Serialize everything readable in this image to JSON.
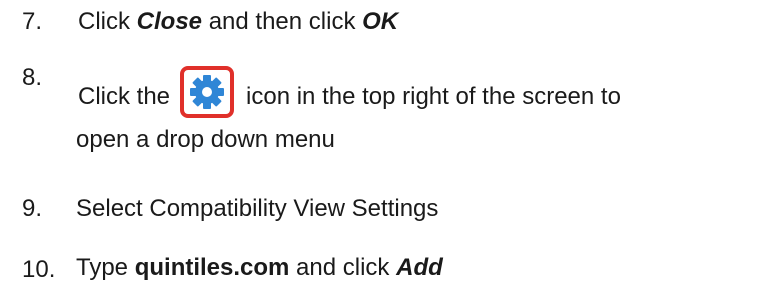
{
  "steps": [
    {
      "number": "7.",
      "parts": {
        "a": "Click ",
        "b": "Close",
        "c": " and then click ",
        "d": "OK"
      }
    },
    {
      "number": "8.",
      "parts": {
        "a": "Click the",
        "c": "icon in the top right of the screen to",
        "line2": "open a drop down menu"
      },
      "icon": "gear-settings-icon",
      "icon_colors": {
        "border": "#e0302a",
        "gear": "#2f86d6",
        "background": "#ffffff"
      }
    },
    {
      "number": "9.",
      "parts": {
        "a": "Select Compatibility View Settings"
      }
    },
    {
      "number": "10.",
      "parts": {
        "a": "Type ",
        "b": "quintiles.com",
        "c": " and click ",
        "d": "Add"
      }
    }
  ]
}
